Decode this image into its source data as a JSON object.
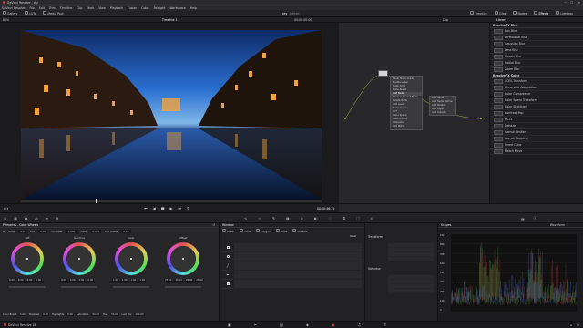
{
  "titlebar": {
    "title": "DaVinci Resolve - sky"
  },
  "menubar": {
    "items": [
      "DaVinci Resolve",
      "File",
      "Edit",
      "Trim",
      "Timeline",
      "Clip",
      "Mark",
      "View",
      "Playback",
      "Fusion",
      "Color",
      "Fairlight",
      "Workspace",
      "Help"
    ]
  },
  "toolbar": {
    "left": [
      "Gallery",
      "LUTs",
      "Media Pool"
    ],
    "center": "sky",
    "center_sub": "Edited",
    "right": [
      "Timeline",
      "Clips",
      "Nodes",
      "Effects",
      "Lightbox"
    ]
  },
  "viewer_header": {
    "zoom": "60%",
    "timeline": "Timeline 1",
    "timecode": "00:00:00:00",
    "clip_label": "Clip",
    "library": "Library"
  },
  "node_menu": {
    "items": [
      "Reset Node Grade",
      "Enable Label",
      "Node Color",
      "Node Reset",
      "Add Node",
      "Save as Shared Node",
      "Delete Node",
      "Add Level",
      "Node Layer",
      "LUT",
      "Color Space",
      "Gamut Limit",
      "Character",
      "Add Matte"
    ],
    "submenu": [
      "Add Serial",
      "Add Serial Before",
      "Add Parallel",
      "Add Layer",
      "Add Outside"
    ]
  },
  "library": {
    "sections": [
      {
        "title": "ResolveFX Blur",
        "items": [
          "Box Blur",
          "Directional Blur",
          "Gaussian Blur",
          "Lens Blur",
          "Mosaic Blur",
          "Radial Blur",
          "Zoom Blur"
        ]
      },
      {
        "title": "ResolveFX Color",
        "items": [
          "ACES Transform",
          "Chromatic Adaptation",
          "Color Compressor",
          "Color Space Transform",
          "Color Stabilizer",
          "Contrast Pop",
          "DCTL",
          "Dehaze",
          "Gamut Limiter",
          "Gamut Mapping",
          "Invert Color",
          "Match Move"
        ]
      }
    ]
  },
  "playback": {
    "timecode": "00:00:46:15"
  },
  "primaries": {
    "title": "Primaries - Color Wheels",
    "temp": "0.0",
    "tint": "0.00",
    "contrast": "1.000",
    "pivot": "0.435",
    "mid_detail": "0.00",
    "wheels": [
      {
        "label": "Lift",
        "values": [
          "0.00",
          "0.00",
          "0.00",
          "0.00"
        ]
      },
      {
        "label": "Gamma",
        "values": [
          "0.00",
          "0.00",
          "0.00",
          "0.00"
        ]
      },
      {
        "label": "Gain",
        "values": [
          "1.00",
          "1.00",
          "1.00",
          "1.00"
        ]
      },
      {
        "label": "Offset",
        "values": [
          "25.00",
          "25.00",
          "25.00",
          "25.00"
        ]
      }
    ],
    "bottom": [
      "Color Boost",
      "0.00",
      "Shadows",
      "0.00",
      "Highlights",
      "0.00",
      "Saturation",
      "50.00",
      "Hue",
      "50.00",
      "Lum Mix",
      "100.00"
    ]
  },
  "window": {
    "title": "Window",
    "tools": [
      "Linear",
      "Circle",
      "Polygon",
      "Curve",
      "Gradient"
    ],
    "reset": "Reset",
    "transform": "Transform",
    "softness": "Softness"
  },
  "scopes": {
    "title": "Scopes",
    "mode": "Waveform",
    "ticks": [
      "1023",
      "896",
      "768",
      "640",
      "512",
      "384",
      "256",
      "128",
      "0"
    ]
  },
  "status": {
    "app": "DaVinci Resolve 18"
  }
}
